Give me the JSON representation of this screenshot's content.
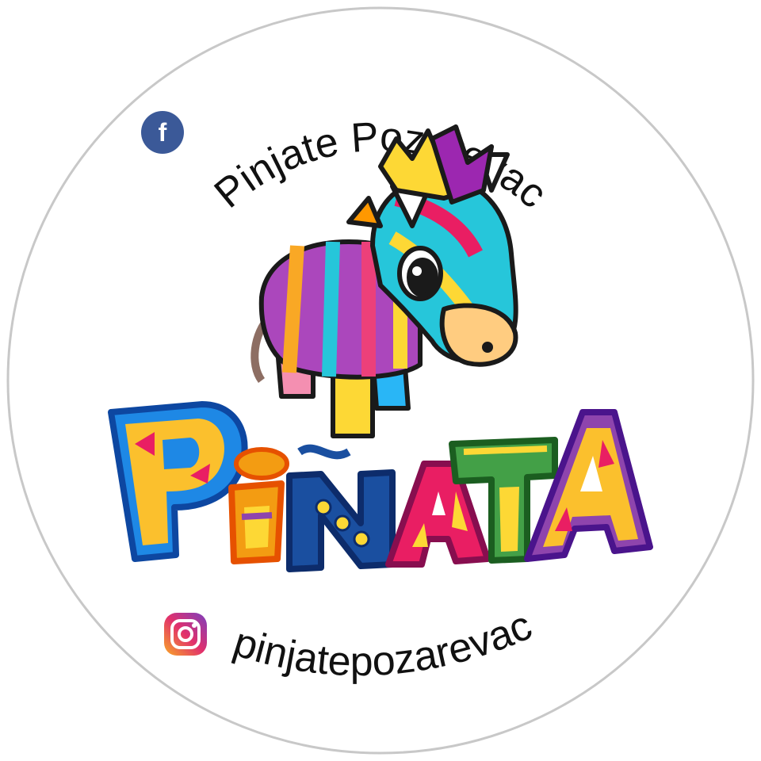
{
  "sticker": {
    "facebook_handle": "Pinjate Pozarevac",
    "instagram_handle": "pinjatepozarevac",
    "logo_word": "PIÑATA"
  },
  "icons": {
    "facebook": "facebook-icon",
    "instagram": "instagram-icon",
    "mascot": "donkey-pinata-illustration"
  },
  "colors": {
    "facebook_blue": "#3b5998",
    "instagram_pink": "#d6336c",
    "circle_border": "#c8c8c8",
    "letter_blue": "#1e88e5",
    "letter_orange": "#f39c12",
    "letter_navy": "#1a4fa0",
    "letter_magenta": "#e91e63",
    "letter_green": "#43a047",
    "letter_purple": "#8e44ad",
    "letter_yellow": "#fbc02d"
  }
}
